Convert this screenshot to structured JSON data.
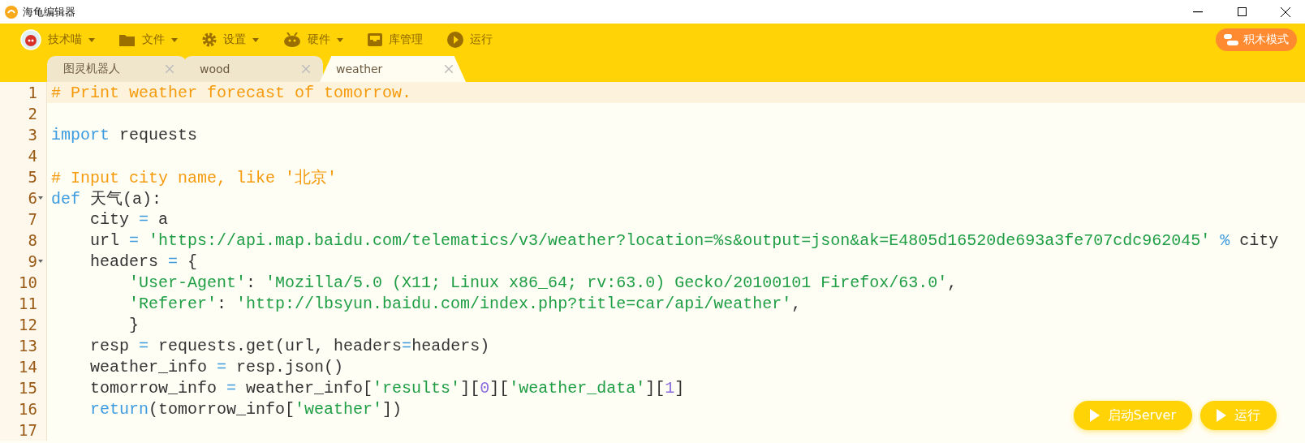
{
  "window": {
    "title": "海龟编辑器"
  },
  "toolbar": {
    "items": [
      {
        "kind": "avatar",
        "label": "技术喵",
        "dropdown": true
      },
      {
        "kind": "folder",
        "label": "文件",
        "dropdown": true
      },
      {
        "kind": "gear",
        "label": "设置",
        "dropdown": true
      },
      {
        "kind": "robot",
        "label": "硬件",
        "dropdown": true
      },
      {
        "kind": "tray",
        "label": "库管理",
        "dropdown": false
      },
      {
        "kind": "play",
        "label": "运行",
        "dropdown": false
      }
    ],
    "mode_button": "积木模式"
  },
  "tabs": [
    {
      "label": "图灵机器人",
      "selected": false
    },
    {
      "label": "wood",
      "selected": false
    },
    {
      "label": "weather",
      "selected": true
    }
  ],
  "editor": {
    "lines": [
      {
        "number": "1",
        "current": true,
        "foldable": false,
        "tokens": [
          {
            "kind": "comment",
            "text": "# Print weather forecast of tomorrow."
          }
        ]
      },
      {
        "number": "2",
        "current": false,
        "foldable": false
      },
      {
        "number": "3",
        "current": false,
        "foldable": false,
        "tokens": [
          {
            "kind": "keyword",
            "text": "import"
          },
          {
            "kind": "plain",
            "text": " requests"
          }
        ]
      },
      {
        "number": "4",
        "current": false,
        "foldable": false
      },
      {
        "number": "5",
        "current": false,
        "foldable": false,
        "tokens": [
          {
            "kind": "comment",
            "text": "# Input city name, like '北京'"
          }
        ]
      },
      {
        "number": "6",
        "current": false,
        "foldable": true,
        "tokens": [
          {
            "kind": "keyword",
            "text": "def"
          },
          {
            "kind": "plain",
            "text": " 天气(a):"
          }
        ]
      },
      {
        "number": "7",
        "current": false,
        "foldable": false,
        "tokens": [
          {
            "kind": "plain",
            "text": "    city "
          },
          {
            "kind": "operator",
            "text": "="
          },
          {
            "kind": "plain",
            "text": " a"
          }
        ]
      },
      {
        "number": "8",
        "current": false,
        "foldable": false,
        "tokens": [
          {
            "kind": "plain",
            "text": "    url "
          },
          {
            "kind": "operator",
            "text": "="
          },
          {
            "kind": "string",
            "text": " 'https://api.map.baidu.com/telematics/v3/weather?location=%s&output=json&ak=E4805d16520de693a3fe707cdc962045'"
          },
          {
            "kind": "operator",
            "text": " %"
          },
          {
            "kind": "plain",
            "text": " city"
          }
        ]
      },
      {
        "number": "9",
        "current": false,
        "foldable": true,
        "tokens": [
          {
            "kind": "plain",
            "text": "    headers "
          },
          {
            "kind": "operator",
            "text": "="
          },
          {
            "kind": "plain",
            "text": " {"
          }
        ]
      },
      {
        "number": "10",
        "current": false,
        "foldable": false,
        "tokens": [
          {
            "kind": "string",
            "text": "        'User-Agent'"
          },
          {
            "kind": "plain",
            "text": ": "
          },
          {
            "kind": "string",
            "text": "'Mozilla/5.0 (X11; Linux x86_64; rv:63.0) Gecko/20100101 Firefox/63.0'"
          },
          {
            "kind": "plain",
            "text": ","
          }
        ]
      },
      {
        "number": "11",
        "current": false,
        "foldable": false,
        "tokens": [
          {
            "kind": "string",
            "text": "        'Referer'"
          },
          {
            "kind": "plain",
            "text": ": "
          },
          {
            "kind": "string",
            "text": "'http://lbsyun.baidu.com/index.php?title=car/api/weather'"
          },
          {
            "kind": "plain",
            "text": ","
          }
        ]
      },
      {
        "number": "12",
        "current": false,
        "foldable": false,
        "tokens": [
          {
            "kind": "plain",
            "text": "        }"
          }
        ]
      },
      {
        "number": "13",
        "current": false,
        "foldable": false,
        "tokens": [
          {
            "kind": "plain",
            "text": "    resp "
          },
          {
            "kind": "operator",
            "text": "="
          },
          {
            "kind": "plain",
            "text": " requests.get(url, headers"
          },
          {
            "kind": "operator",
            "text": "="
          },
          {
            "kind": "plain",
            "text": "headers)"
          }
        ]
      },
      {
        "number": "14",
        "current": false,
        "foldable": false,
        "tokens": [
          {
            "kind": "plain",
            "text": "    weather_info "
          },
          {
            "kind": "operator",
            "text": "="
          },
          {
            "kind": "plain",
            "text": " resp.json()"
          }
        ]
      },
      {
        "number": "15",
        "current": false,
        "foldable": false,
        "tokens": [
          {
            "kind": "plain",
            "text": "    tomorrow_info "
          },
          {
            "kind": "operator",
            "text": "="
          },
          {
            "kind": "plain",
            "text": " weather_info["
          },
          {
            "kind": "string",
            "text": "'results'"
          },
          {
            "kind": "plain",
            "text": "]["
          },
          {
            "kind": "number",
            "text": "0"
          },
          {
            "kind": "plain",
            "text": "]["
          },
          {
            "kind": "string",
            "text": "'weather_data'"
          },
          {
            "kind": "plain",
            "text": "]["
          },
          {
            "kind": "number",
            "text": "1"
          },
          {
            "kind": "plain",
            "text": "]"
          }
        ]
      },
      {
        "number": "16",
        "current": false,
        "foldable": false,
        "tokens": [
          {
            "kind": "keyword",
            "text": "    return"
          },
          {
            "kind": "plain",
            "text": "(tomorrow_info["
          },
          {
            "kind": "string",
            "text": "'weather'"
          },
          {
            "kind": "plain",
            "text": "])"
          }
        ]
      },
      {
        "number": "17",
        "current": false,
        "foldable": false
      }
    ]
  },
  "run_buttons": [
    "启动Server",
    "运行"
  ]
}
